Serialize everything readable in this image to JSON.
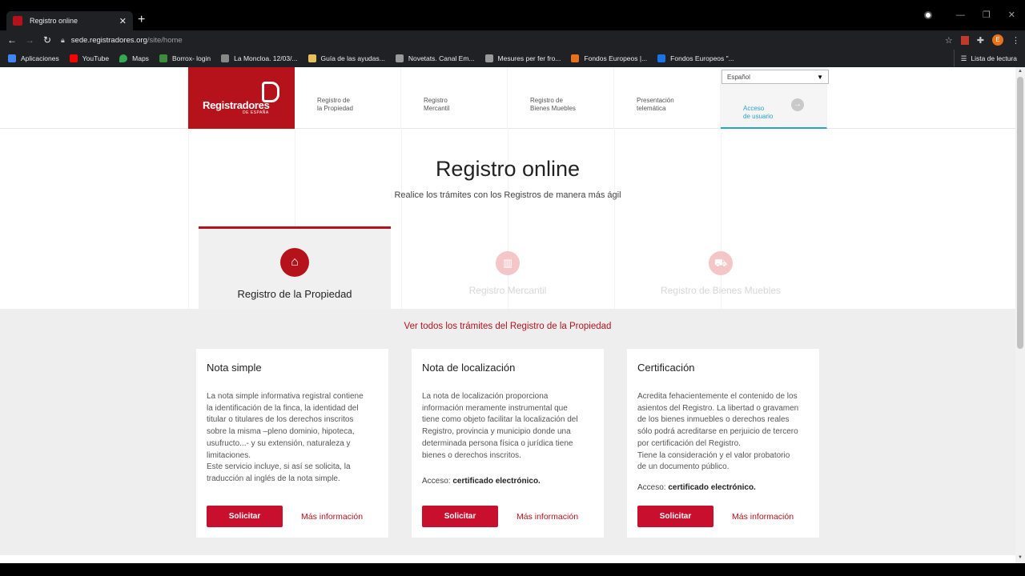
{
  "browser": {
    "tab_title": "Registro online",
    "url_host": "sede.registradores.org",
    "url_path": "/site/home",
    "avatar_letter": "E",
    "bookmarks": [
      {
        "label": "Aplicaciones",
        "color": "#4285f4"
      },
      {
        "label": "YouTube",
        "color": "#ff0000"
      },
      {
        "label": "Maps",
        "color": "#34a853"
      },
      {
        "label": "Borrox- login",
        "color": "#3b8d3b"
      },
      {
        "label": "La Moncloa. 12/03/...",
        "color": "#888888"
      },
      {
        "label": "Guía de las ayudas...",
        "color": "#e6c05a"
      },
      {
        "label": "Novetats. Canal Em...",
        "color": "#999999"
      },
      {
        "label": "Mesures per fer fro...",
        "color": "#999999"
      },
      {
        "label": "Fondos Europeos |...",
        "color": "#e8711c"
      },
      {
        "label": "Fondos Europeos \"...",
        "color": "#1a73e8"
      }
    ],
    "reading_list": "Lista de lectura"
  },
  "header": {
    "logo_text": "Registradores",
    "logo_sub": "DE ESPAÑA",
    "language": "Español",
    "nav": [
      {
        "label": "Registro de\nla Propiedad"
      },
      {
        "label": "Registro\nMercantil"
      },
      {
        "label": "Registro de\nBienes Muebles"
      },
      {
        "label": "Presentación\ntelemática"
      },
      {
        "label": "Acceso\nde usuario"
      }
    ]
  },
  "hero": {
    "title": "Registro online",
    "subtitle": "Realice los trámites con los Registros de manera más ágil",
    "tabs": [
      {
        "label": "Registro de la Propiedad",
        "icon": "house-icon"
      },
      {
        "label": "Registro Mercantil",
        "icon": "building-icon"
      },
      {
        "label": "Registro de Bienes Muebles",
        "icon": "car-icon"
      }
    ]
  },
  "services": {
    "see_all": "Ver todos los trámites del Registro de la Propiedad",
    "cards": [
      {
        "title": "Nota simple",
        "body": "La nota simple informativa registral contiene\nla identificación de la finca, la identidad del\ntitular o titulares de los derechos inscritos\nsobre la misma –pleno dominio, hipoteca,\nusufructo...- y su extensión, naturaleza y\nlimitaciones.\nEste servicio incluye, si así se solicita, la\ntraducción al inglés de la nota simple.",
        "access_label": "",
        "access_value": "",
        "button": "Solicitar",
        "more": "Más información"
      },
      {
        "title": "Nota de localización",
        "body": "La nota de localización proporciona\ninformación meramente instrumental que\ntiene como objeto facilitar la localización del\nRegistro, provincia y municipio donde una\ndeterminada persona física o jurídica tiene\nbienes o derechos inscritos.",
        "access_label": "Acceso: ",
        "access_value": "certificado electrónico.",
        "button": "Solicitar",
        "more": "Más información"
      },
      {
        "title": "Certificación",
        "body": "Acredita fehacientemente el contenido de los\nasientos del Registro. La libertad o gravamen\nde los bienes inmuebles o derechos reales\nsólo podrá acreditarse en perjuicio de tercero\npor certificación del Registro.\nTiene la consideración y el valor probatorio\nde un documento público.",
        "access_label": "Acceso: ",
        "access_value": "certificado electrónico.",
        "button": "Solicitar",
        "more": "Más información"
      }
    ]
  },
  "colors": {
    "brand": "#b5121b",
    "link_blue": "#2aa1c7"
  }
}
